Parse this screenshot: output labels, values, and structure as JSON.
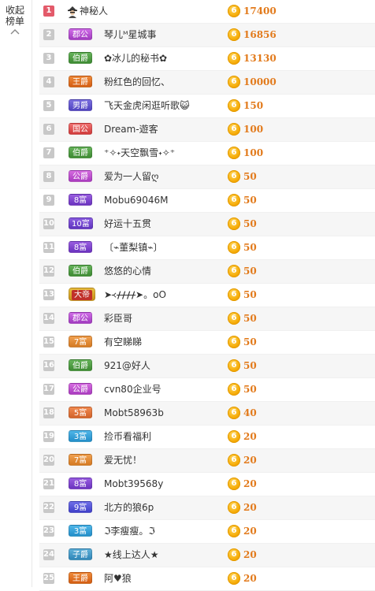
{
  "sidebar": {
    "collapse_line1": "收起",
    "collapse_line2": "榜单"
  },
  "coin_glyph": "6",
  "colors": {
    "top_rank": "#e35a6a",
    "amount": "#e27a1b",
    "coin": "#f5a800"
  },
  "rows": [
    {
      "rank": "1",
      "badge": "",
      "name": "神秘人",
      "amount": "17400"
    },
    {
      "rank": "2",
      "badge": "郡公",
      "name": "琴儿ᴹ星城事",
      "amount": "16856"
    },
    {
      "rank": "3",
      "badge": "伯爵",
      "name": "✿冰儿的秘书✿",
      "amount": "13130"
    },
    {
      "rank": "4",
      "badge": "王爵",
      "name": "粉红色的回忆、",
      "amount": "10000"
    },
    {
      "rank": "5",
      "badge": "男爵",
      "name": "飞天金虎闲逛听歌😺",
      "amount": "150"
    },
    {
      "rank": "6",
      "badge": "国公",
      "name": "Dream-遊客",
      "amount": "100"
    },
    {
      "rank": "7",
      "badge": "伯爵",
      "name": "⁺✧˖天空飘雪˖✧⁺",
      "amount": "100"
    },
    {
      "rank": "8",
      "badge": "公爵",
      "name": "爱为一人留ღ",
      "amount": "50"
    },
    {
      "rank": "9",
      "badge": "8富",
      "name": "Mobu69046M",
      "amount": "50"
    },
    {
      "rank": "10",
      "badge": "10富",
      "name": "好运十五贯",
      "amount": "50"
    },
    {
      "rank": "11",
      "badge": "8富",
      "name": "〔⌁董梨镇⌁〕",
      "amount": "50"
    },
    {
      "rank": "12",
      "badge": "伯爵",
      "name": "悠悠的心情",
      "amount": "50"
    },
    {
      "rank": "13",
      "badge": "大帝",
      "name": "➤᚜ᚋᚋᚋᚋ➤。oO",
      "amount": "50"
    },
    {
      "rank": "14",
      "badge": "郡公",
      "name": "彩臣哥",
      "amount": "50"
    },
    {
      "rank": "15",
      "badge": "7富",
      "name": "有空睇睇",
      "amount": "50"
    },
    {
      "rank": "16",
      "badge": "伯爵",
      "name": "921@好人",
      "amount": "50"
    },
    {
      "rank": "17",
      "badge": "公爵",
      "name": "cvn80企业号",
      "amount": "50"
    },
    {
      "rank": "18",
      "badge": "5富",
      "name": "Mobt58963b",
      "amount": "40"
    },
    {
      "rank": "19",
      "badge": "3富",
      "name": "捡币看福利",
      "amount": "20"
    },
    {
      "rank": "20",
      "badge": "7富",
      "name": "爱无忧！",
      "amount": "20"
    },
    {
      "rank": "21",
      "badge": "8富",
      "name": "Mobt39568y",
      "amount": "20"
    },
    {
      "rank": "22",
      "badge": "9富",
      "name": "北方的狼6p",
      "amount": "20"
    },
    {
      "rank": "23",
      "badge": "3富",
      "name": "ℑ李瘦瘦。ℑ",
      "amount": "20"
    },
    {
      "rank": "24",
      "badge": "子爵",
      "name": "★线上达人★",
      "amount": "20"
    },
    {
      "rank": "25",
      "badge": "王爵",
      "name": "阿♥狼",
      "amount": "20"
    }
  ]
}
